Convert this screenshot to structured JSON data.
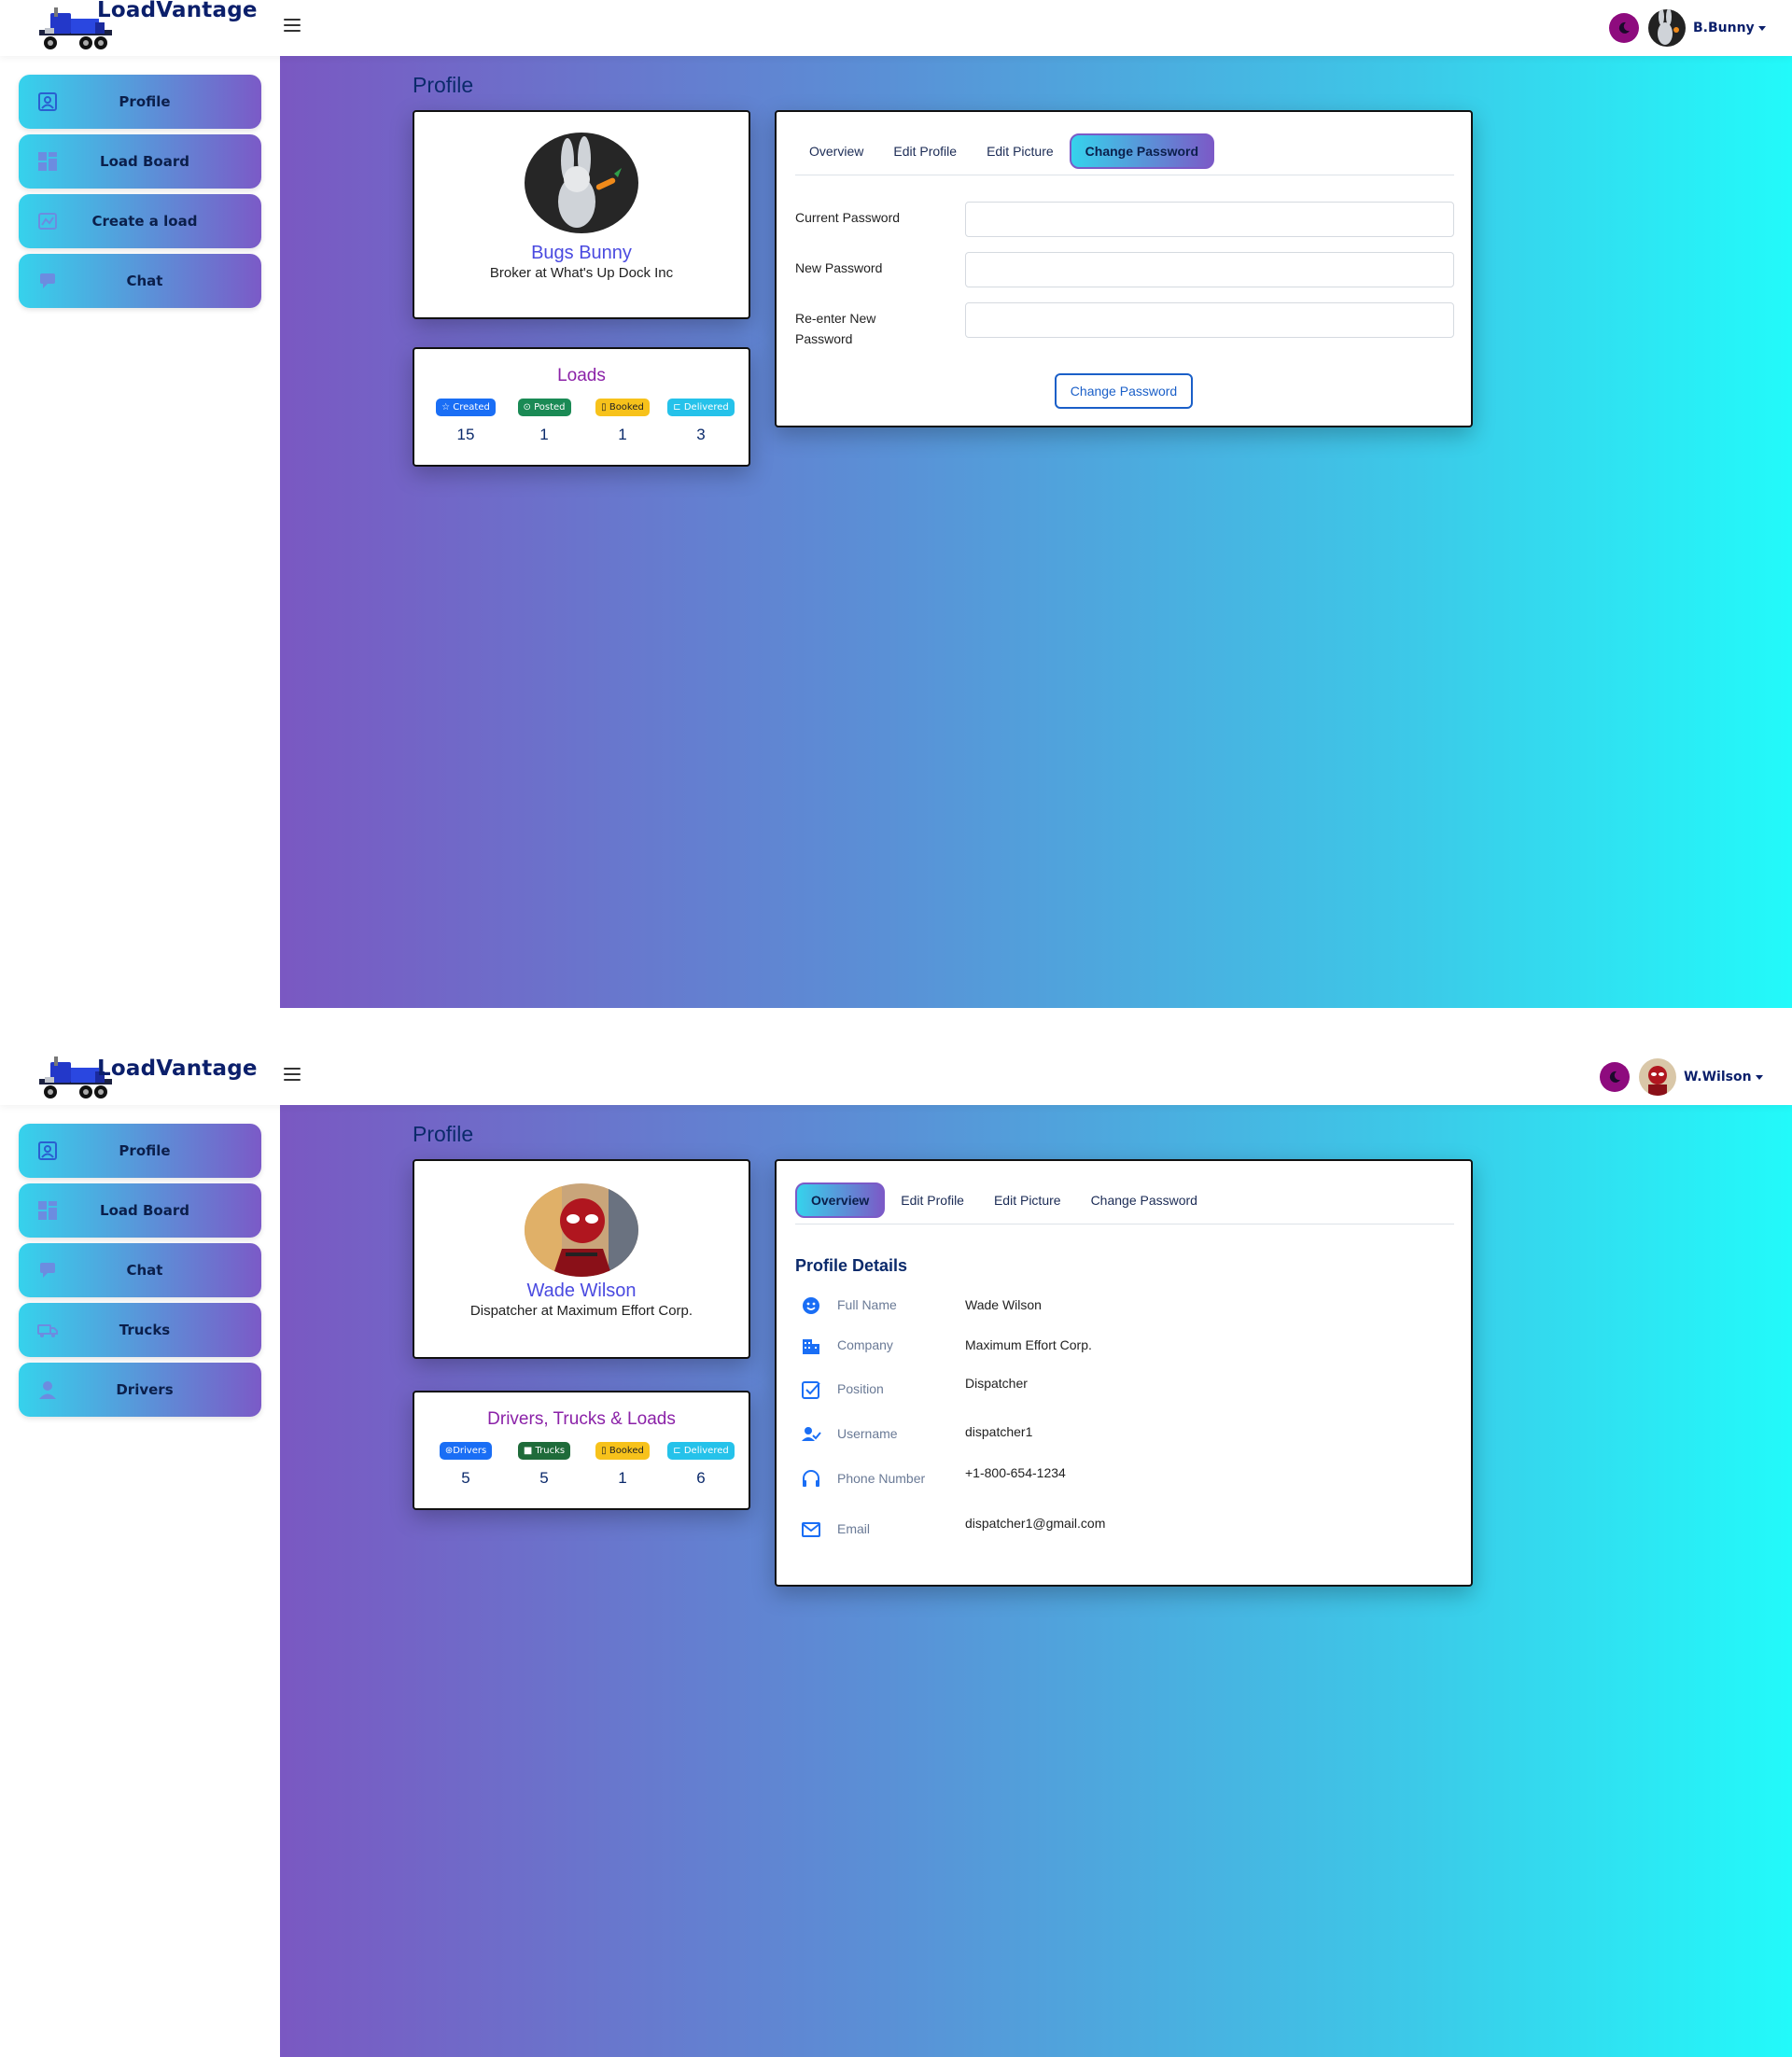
{
  "brand": "LoadVantage",
  "colors": {
    "accent": "#7b5ac7",
    "cyan": "#36d2ec",
    "navy": "#0b2a6b",
    "badge_blue": "#1a6ef5",
    "badge_green": "#1a8a55",
    "badge_yellow": "#f7c21b",
    "badge_cyan": "#25c2ea"
  },
  "screen1": {
    "user": {
      "name": "B.Bunny"
    },
    "sidebar": [
      {
        "label": "Profile",
        "icon": "profile-icon"
      },
      {
        "label": "Load Board",
        "icon": "dashboard-icon"
      },
      {
        "label": "Create a load",
        "icon": "map-icon"
      },
      {
        "label": "Chat",
        "icon": "chat-icon"
      }
    ],
    "page_title": "Profile",
    "profile": {
      "name": "Bugs Bunny",
      "role": "Broker at What's Up Dock Inc"
    },
    "stats": {
      "title": "Loads",
      "items": [
        {
          "label": "Created",
          "value": "15",
          "icon": "star-icon"
        },
        {
          "label": "Posted",
          "value": "1",
          "icon": "check-circle-icon"
        },
        {
          "label": "Booked",
          "value": "1",
          "icon": "bookmark-icon"
        },
        {
          "label": "Delivered",
          "value": "3",
          "icon": "truck-icon"
        }
      ]
    },
    "tabs": [
      "Overview",
      "Edit Profile",
      "Edit Picture",
      "Change Password"
    ],
    "active_tab": "Change Password",
    "form": {
      "current_password": {
        "label": "Current Password",
        "value": ""
      },
      "new_password": {
        "label": "New Password",
        "value": ""
      },
      "reenter_password": {
        "label_line1": "Re-enter New",
        "label_line2": "Password",
        "value": ""
      },
      "submit": "Change Password"
    }
  },
  "screen2": {
    "user": {
      "name": "W.Wilson"
    },
    "sidebar": [
      {
        "label": "Profile",
        "icon": "profile-icon"
      },
      {
        "label": "Load Board",
        "icon": "dashboard-icon"
      },
      {
        "label": "Chat",
        "icon": "chat-icon"
      },
      {
        "label": "Trucks",
        "icon": "truck-icon"
      },
      {
        "label": "Drivers",
        "icon": "person-icon"
      }
    ],
    "page_title": "Profile",
    "profile": {
      "name": "Wade Wilson",
      "role": "Dispatcher at Maximum Effort Corp."
    },
    "stats": {
      "title": "Drivers, Trucks & Loads",
      "items": [
        {
          "label": "Drivers",
          "value": "5",
          "icon": "steering-wheel-icon"
        },
        {
          "label": "Trucks",
          "value": "5",
          "icon": "truck-icon"
        },
        {
          "label": "Booked",
          "value": "1",
          "icon": "bookmark-icon"
        },
        {
          "label": "Delivered",
          "value": "6",
          "icon": "truck-icon"
        }
      ]
    },
    "tabs": [
      "Overview",
      "Edit Profile",
      "Edit Picture",
      "Change Password"
    ],
    "active_tab": "Overview",
    "details": {
      "title": "Profile Details",
      "rows": [
        {
          "label": "Full Name",
          "value": "Wade Wilson",
          "icon": "smile-icon"
        },
        {
          "label": "Company",
          "value": "Maximum Effort Corp.",
          "icon": "building-icon"
        },
        {
          "label": "Position",
          "value": "Dispatcher",
          "icon": "check-square-icon"
        },
        {
          "label": "Username",
          "value": "dispatcher1",
          "icon": "user-check-icon"
        },
        {
          "label": "Phone Number",
          "value": "+1-800-654-1234",
          "icon": "headset-icon"
        },
        {
          "label": "Email",
          "value": "dispatcher1@gmail.com",
          "icon": "envelope-icon"
        }
      ]
    }
  }
}
